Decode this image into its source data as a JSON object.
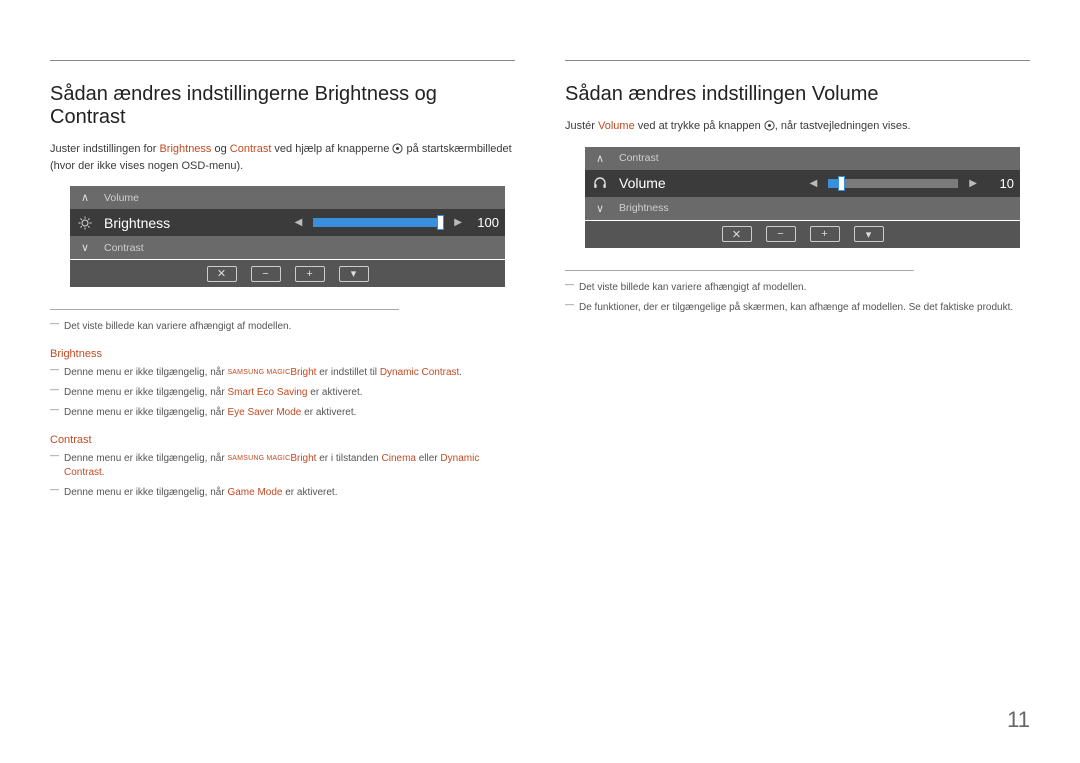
{
  "left": {
    "heading": "Sådan ændres indstillingerne Brightness og Contrast",
    "intro_1a": "Juster indstillingen for ",
    "intro_1b": "Brightness",
    "intro_1c": " og ",
    "intro_1d": "Contrast",
    "intro_1e": " ved hjælp af knapperne ",
    "intro_1f": " på startskærmbilledet (hvor der ikke vises nogen OSD-menu).",
    "osd": {
      "top_sub_label": "Volume",
      "main_label": "Brightness",
      "value": "100",
      "bottom_sub_label": "Contrast"
    },
    "note_a": "Det viste billede kan variere afhængigt af modellen.",
    "subhead_brightness": "Brightness",
    "note_b_1": "Denne menu er ikke tilgængelig, når ",
    "magic_small": "SAMSUNG MAGIC",
    "magic_bright": "Bright",
    "note_b_2": " er indstillet til ",
    "note_b_3": "Dynamic Contrast",
    "note_b_4": ".",
    "note_c_1": "Denne menu er ikke tilgængelig, når ",
    "note_c_2": "Smart Eco Saving",
    "note_c_3": " er aktiveret.",
    "note_d_1": "Denne menu er ikke tilgængelig, når ",
    "note_d_2": "Eye Saver Mode",
    "note_d_3": " er aktiveret.",
    "subhead_contrast": "Contrast",
    "note_e_1": "Denne menu er ikke tilgængelig, når ",
    "note_e_2": " er i tilstanden ",
    "note_e_3": "Cinema",
    "note_e_4": " eller ",
    "note_e_5": "Dynamic Contrast",
    "note_e_6": ".",
    "note_f_1": "Denne menu er ikke tilgængelig, når ",
    "note_f_2": "Game Mode",
    "note_f_3": " er aktiveret."
  },
  "right": {
    "heading": "Sådan ændres indstillingen Volume",
    "intro_1a": "Justér ",
    "intro_1b": "Volume",
    "intro_1c": " ved at trykke på knappen ",
    "intro_1d": ", når tastvejledningen vises.",
    "osd": {
      "top_sub_label": "Contrast",
      "main_label": "Volume",
      "value": "10",
      "bottom_sub_label": "Brightness"
    },
    "note_a": "Det viste billede kan variere afhængigt af modellen.",
    "note_b": "De funktioner, der er tilgængelige på skærmen, kan afhænge af modellen. Se det faktiske produkt."
  },
  "footer_buttons": {
    "close": "✕",
    "minus": "−",
    "plus": "+",
    "down": "▾"
  },
  "page_number": "11",
  "chart_data": [
    {
      "type": "bar",
      "title": "Brightness OSD slider",
      "categories": [
        "Brightness"
      ],
      "values": [
        100
      ],
      "ylim": [
        0,
        100
      ]
    },
    {
      "type": "bar",
      "title": "Volume OSD slider",
      "categories": [
        "Volume"
      ],
      "values": [
        10
      ],
      "ylim": [
        0,
        100
      ]
    }
  ]
}
